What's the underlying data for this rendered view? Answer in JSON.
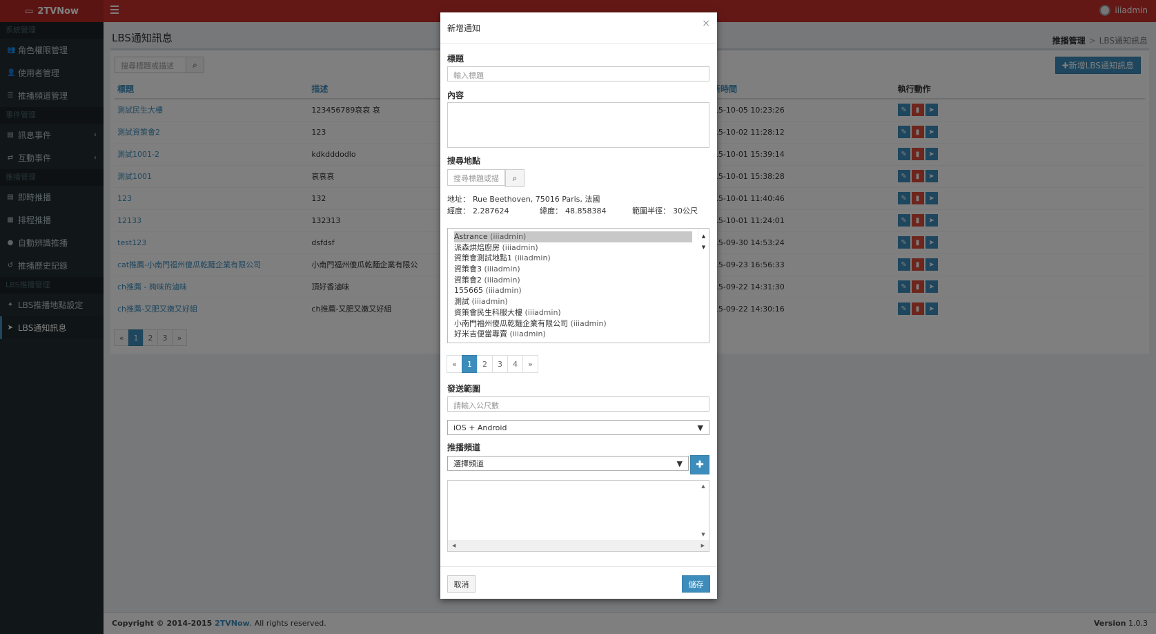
{
  "app": {
    "brand": "2TVNow",
    "user": "iiiadmin"
  },
  "sidebar": {
    "sections": [
      {
        "header": "系統管理",
        "items": [
          {
            "label": "角色權限管理",
            "icon": "users-icon",
            "glyph": "👥"
          },
          {
            "label": "使用者管理",
            "icon": "user-icon",
            "glyph": "👤"
          },
          {
            "label": "推播頻道管理",
            "icon": "rss-icon",
            "glyph": "☰"
          }
        ]
      },
      {
        "header": "事件管理",
        "items": [
          {
            "label": "訊息事件",
            "icon": "keyboard-icon",
            "glyph": "▤",
            "arrow": "‹"
          },
          {
            "label": "互動事件",
            "icon": "exchange-icon",
            "glyph": "⇄",
            "arrow": "‹"
          }
        ]
      },
      {
        "header": "推播管理",
        "items": [
          {
            "label": "即時推播",
            "icon": "keyboard-icon",
            "glyph": "▤"
          },
          {
            "label": "排程推播",
            "icon": "calendar-icon",
            "glyph": "▦"
          },
          {
            "label": "自動辨識推播",
            "icon": "microphone-icon",
            "glyph": "●"
          },
          {
            "label": "推播歷史記錄",
            "icon": "history-icon",
            "glyph": "↺"
          }
        ]
      },
      {
        "header": "LBS推播管理",
        "items": [
          {
            "label": "LBS推播地點設定",
            "icon": "pin-icon",
            "glyph": "✦"
          },
          {
            "label": "LBS通知訊息",
            "icon": "send-icon",
            "glyph": "➤",
            "active": true
          }
        ]
      }
    ]
  },
  "page": {
    "title": "LBS通知訊息",
    "breadcrumb": [
      "推播管理",
      "LBS通知訊息"
    ],
    "search_placeholder": "搜尋標題或描述",
    "add_button": "✚新增LBS通知訊息"
  },
  "table": {
    "headers": [
      "標題",
      "描述",
      "",
      "更新時間",
      "執行動作"
    ],
    "rows": [
      {
        "title": "測試民生大樓",
        "desc": "123456789哀哀 哀",
        "updated": "2015-10-05 10:23:26"
      },
      {
        "title": "測試資策會2",
        "desc": "123",
        "updated": "2015-10-02 11:28:12"
      },
      {
        "title": "測試1001-2",
        "desc": "kdkdddodlo",
        "updated": "2015-10-01 15:39:14"
      },
      {
        "title": "測試1001",
        "desc": "哀哀哀",
        "updated": "2015-10-01 15:38:28"
      },
      {
        "title": "123",
        "desc": "132",
        "updated": "2015-10-01 11:40:46"
      },
      {
        "title": "12133",
        "desc": "132313",
        "updated": "2015-10-01 11:24:01"
      },
      {
        "title": "test123",
        "desc": "dsfdsf",
        "updated": "2015-09-30 14:53:24"
      },
      {
        "title": "cat推薦-小南門福州傻瓜乾麵企業有限公司",
        "desc": "小南門福州傻瓜乾麵企業有限公",
        "updated": "2015-09-23 16:56:33"
      },
      {
        "title": "ch推薦 - 夠味的滷味",
        "desc": "頂好香滷味",
        "updated": "2015-09-22 14:31:30"
      },
      {
        "title": "ch推薦-又肥又嫩又好組",
        "desc": "ch推薦-又肥又嫩又好組",
        "updated": "2015-09-22 14:30:16"
      }
    ],
    "pager": [
      "«",
      "1",
      "2",
      "3",
      "»"
    ]
  },
  "footer": {
    "prefix": "Copyright © 2014-2015 ",
    "link": "2TVNow",
    "suffix": ". All rights reserved.",
    "version_label": "Version",
    "version": "1.0.3"
  },
  "modal": {
    "title": "新增通知",
    "close": "×",
    "title_label": "標題",
    "title_placeholder": "輸入標題",
    "content_label": "內容",
    "location_label": "搜尋地點",
    "location_placeholder": "搜尋標題或描",
    "address_label": "地址：",
    "address": "Rue Beethoven, 75016 Paris, 法國",
    "lng_label": "經度：",
    "lng": "2.287624",
    "lat_label": "緯度：",
    "lat": "48.858384",
    "radius_label": "範圍半徑：",
    "radius": "30公尺",
    "places": [
      {
        "name": "Astrance",
        "owner": "(iiiadmin)",
        "selected": true
      },
      {
        "name": "派森烘焙廚房",
        "owner": "(iiiadmin)"
      },
      {
        "name": "資策會測試地點1",
        "owner": "(iiiadmin)"
      },
      {
        "name": "資策會3",
        "owner": "(iiiadmin)"
      },
      {
        "name": "資策會2",
        "owner": "(iiiadmin)"
      },
      {
        "name": "155665",
        "owner": "(iiiadmin)"
      },
      {
        "name": "測試",
        "owner": "(iiiadmin)"
      },
      {
        "name": "資策會民生科服大樓",
        "owner": "(iiiadmin)"
      },
      {
        "name": "小南門福州傻瓜乾麵企業有限公司",
        "owner": "(iiiadmin)"
      },
      {
        "name": "好米吉便當專賣",
        "owner": "(iiiadmin)"
      }
    ],
    "pager": [
      "«",
      "1",
      "2",
      "3",
      "4",
      "»"
    ],
    "range_label": "發送範圍",
    "range_placeholder": "請輸入公尺數",
    "platform": "iOS + Android",
    "channel_label": "推播頻道",
    "channel_select": "選擇頻道",
    "plus": "✚",
    "cancel": "取消",
    "save": "儲存"
  }
}
